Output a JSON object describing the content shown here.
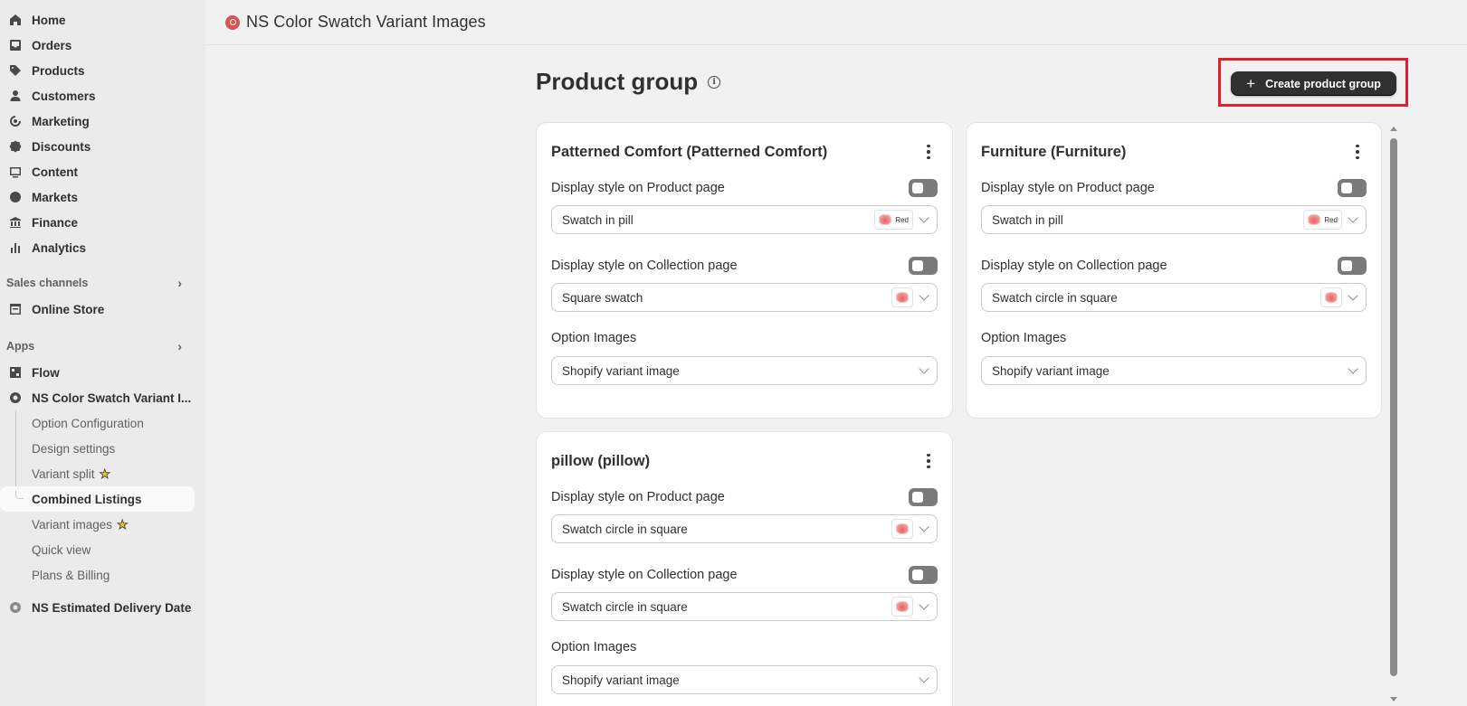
{
  "sidebar": {
    "nav": [
      {
        "label": "Home",
        "icon": "home-icon"
      },
      {
        "label": "Orders",
        "icon": "inbox-icon"
      },
      {
        "label": "Products",
        "icon": "tag-icon"
      },
      {
        "label": "Customers",
        "icon": "person-icon"
      },
      {
        "label": "Marketing",
        "icon": "target-icon"
      },
      {
        "label": "Discounts",
        "icon": "discount-icon"
      },
      {
        "label": "Content",
        "icon": "image-icon"
      },
      {
        "label": "Markets",
        "icon": "globe-icon"
      },
      {
        "label": "Finance",
        "icon": "bank-icon"
      },
      {
        "label": "Analytics",
        "icon": "bar-chart-icon"
      }
    ],
    "sales_channels_label": "Sales channels",
    "online_store": "Online Store",
    "apps_label": "Apps",
    "flow": "Flow",
    "app_name": "NS Color Swatch Variant I...",
    "app_subitems": [
      {
        "label": "Option Configuration"
      },
      {
        "label": "Design settings"
      },
      {
        "label": "Variant split"
      },
      {
        "label": "Combined Listings"
      },
      {
        "label": "Variant images"
      },
      {
        "label": "Quick view"
      },
      {
        "label": "Plans & Billing"
      }
    ],
    "other_app": "NS Estimated Delivery Date"
  },
  "topbar": {
    "title": "NS Color Swatch Variant Images"
  },
  "page": {
    "title": "Product group",
    "create_button": "Create product group"
  },
  "colors": {
    "accent_highlight": "#e0202f",
    "primary_button": "#303030",
    "swatch_red": "#e85f5f"
  },
  "labels": {
    "product_page": "Display style on Product page",
    "collection_page": "Display style on Collection page",
    "option_images": "Option Images"
  },
  "cards": [
    {
      "title": "Patterned Comfort (Patterned Comfort)",
      "product_style": "Swatch in pill",
      "product_swatch_label": "Red",
      "collection_style": "Square swatch",
      "option_images": "Shopify variant image"
    },
    {
      "title": "Furniture (Furniture)",
      "product_style": "Swatch in pill",
      "product_swatch_label": "Red",
      "collection_style": "Swatch circle in square",
      "option_images": "Shopify variant image"
    },
    {
      "title": "pillow (pillow)",
      "product_style": "Swatch circle in square",
      "collection_style": "Swatch circle in square",
      "option_images": "Shopify variant image"
    }
  ]
}
